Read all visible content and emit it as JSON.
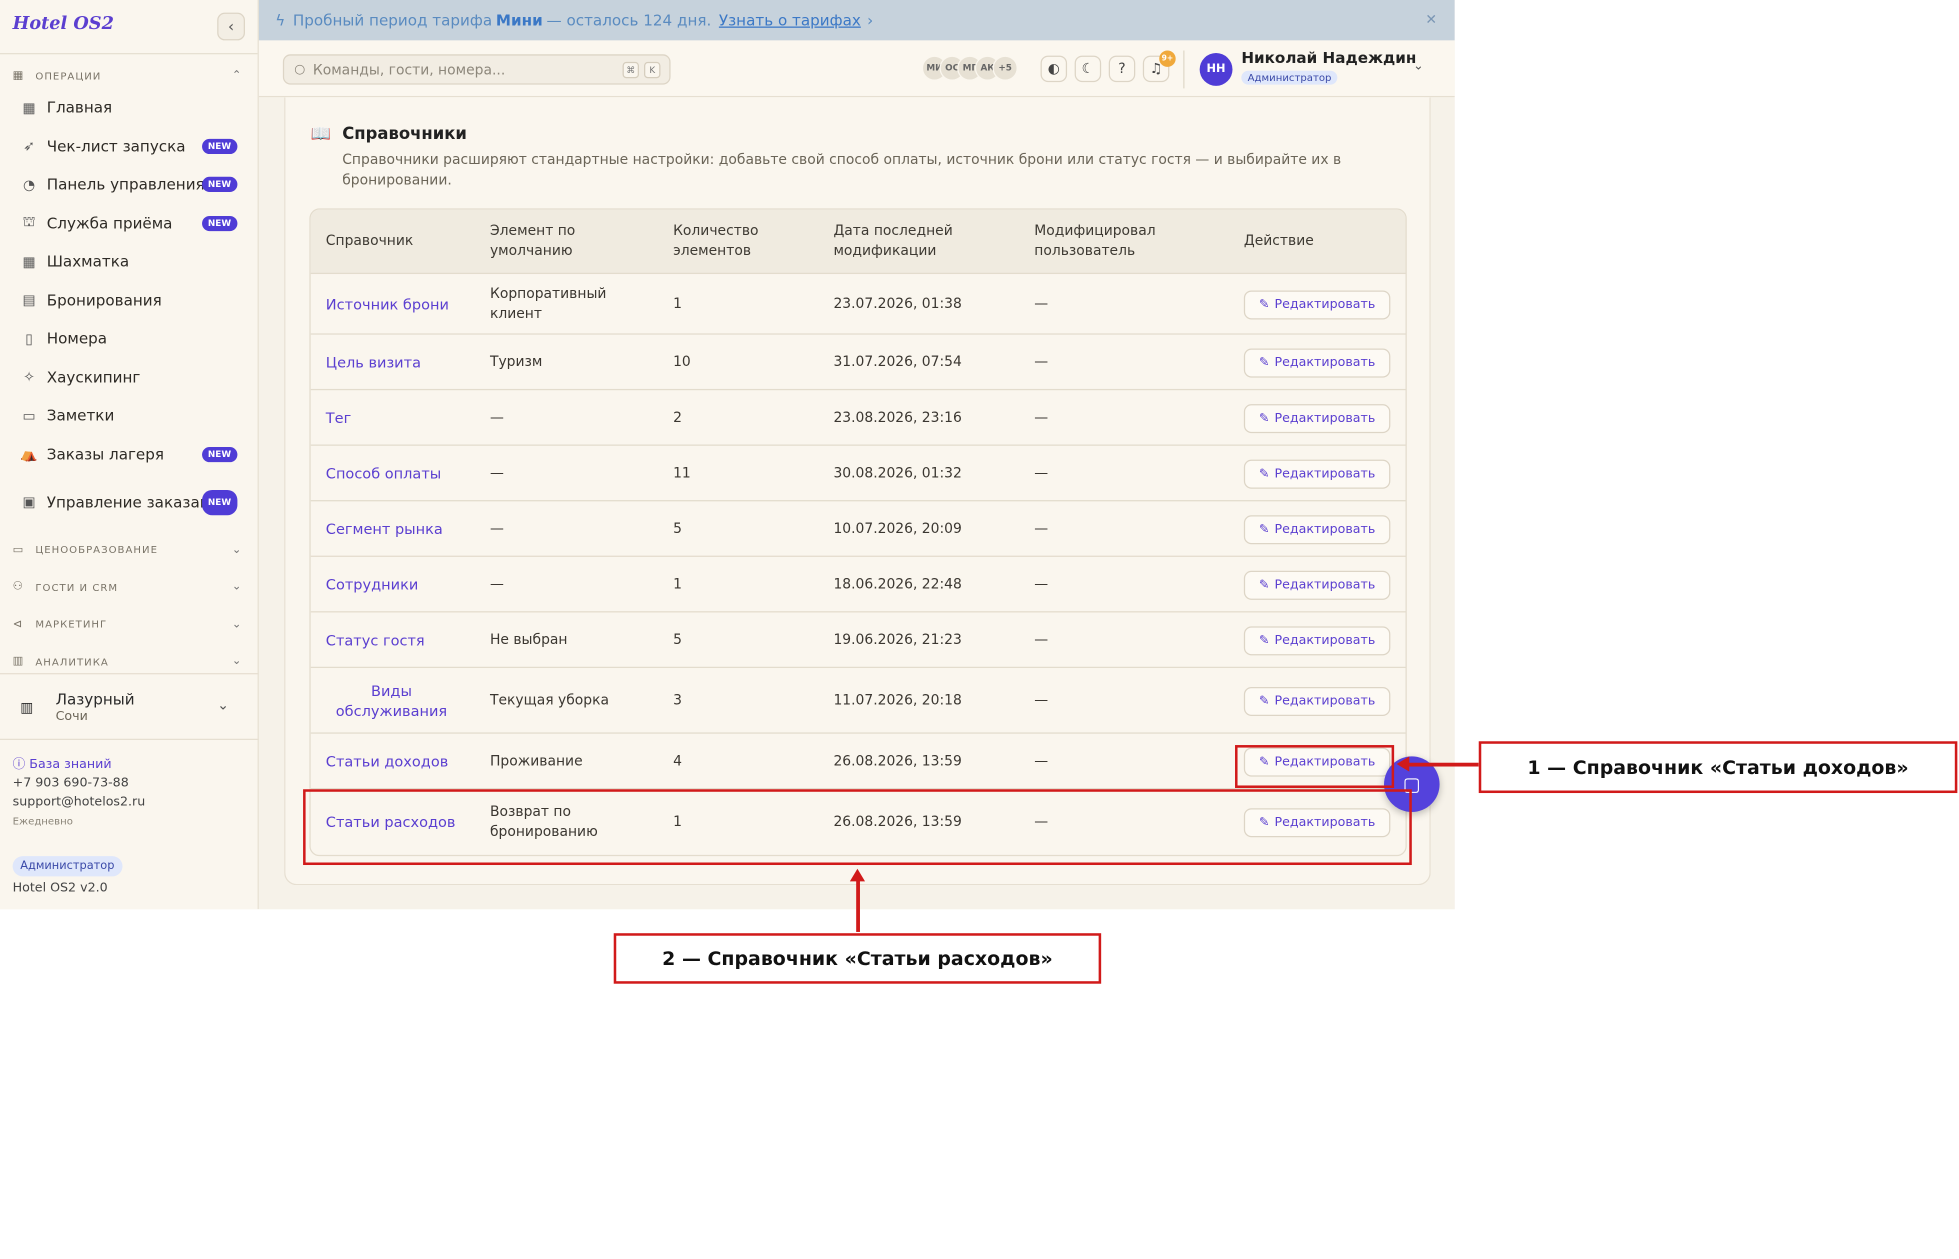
{
  "app": {
    "logo": "Hotel OS2"
  },
  "banner": {
    "text_before": "Пробный период тарифа",
    "plan": "Мини",
    "text_after": "— осталось 124 дня.",
    "link": "Узнать о тарифах"
  },
  "sidebar": {
    "section_operations": "ОПЕРАЦИИ",
    "items": [
      {
        "label": "Главная",
        "icon": "grid-icon",
        "badge": ""
      },
      {
        "label": "Чек-лист запуска",
        "icon": "rocket-icon",
        "badge": "NEW"
      },
      {
        "label": "Панель управления",
        "icon": "gauge-icon",
        "badge": "NEW"
      },
      {
        "label": "Служба приёма",
        "icon": "bell-desk-icon",
        "badge": "NEW"
      },
      {
        "label": "Шахматка",
        "icon": "table-icon",
        "badge": ""
      },
      {
        "label": "Бронирования",
        "icon": "clipboard-icon",
        "badge": ""
      },
      {
        "label": "Номера",
        "icon": "door-icon",
        "badge": ""
      },
      {
        "label": "Хаускипинг",
        "icon": "sparkle-icon",
        "badge": ""
      },
      {
        "label": "Заметки",
        "icon": "note-icon",
        "badge": ""
      },
      {
        "label": "Заказы лагеря",
        "icon": "tent-icon",
        "badge": "NEW"
      },
      {
        "label": "Управление заказами",
        "icon": "receipt-icon",
        "badge": "NEW"
      }
    ],
    "sections": [
      "ЦЕНООБРАЗОВАНИЕ",
      "ГОСТИ И CRM",
      "МАРКЕТИНГ",
      "АНАЛИТИКА"
    ],
    "hotel": {
      "name": "Лазурный",
      "city": "Сочи"
    },
    "knowledge_base": "База знаний",
    "phone": "+7 903 690-73-88",
    "email": "support@hotelos2.ru",
    "hours": "Ежедневно",
    "role": "Администратор",
    "version": "Hotel OS2 v2.0"
  },
  "topbar": {
    "search_placeholder": "Команды, гости, номера...",
    "kbd1": "⌘",
    "kbd2": "K",
    "avatars": [
      "МИ",
      "ОС",
      "МГ",
      "АК",
      "+5"
    ],
    "notif_count": "9+",
    "user_initials": "НН",
    "user_name": "Николай Надеждин",
    "user_role": "Администратор"
  },
  "page": {
    "title": "Справочники",
    "description": "Справочники расширяют стандартные настройки: добавьте свой способ оплаты, источник брони или статус гостя — и выбирайте их в бронировании."
  },
  "table": {
    "headers": [
      "Справочник",
      "Элемент по умолчанию",
      "Количество элементов",
      "Дата последней модификации",
      "Модифицировал пользователь",
      "Действие"
    ],
    "edit_label": "Редактировать",
    "rows": [
      {
        "name": "Источник брони",
        "default": "Корпоративный клиент",
        "count": "1",
        "date": "23.07.2026, 01:38",
        "user": "—"
      },
      {
        "name": "Цель визита",
        "default": "Туризм",
        "count": "10",
        "date": "31.07.2026, 07:54",
        "user": "—"
      },
      {
        "name": "Тег",
        "default": "—",
        "count": "2",
        "date": "23.08.2026, 23:16",
        "user": "—"
      },
      {
        "name": "Способ оплаты",
        "default": "—",
        "count": "11",
        "date": "30.08.2026, 01:32",
        "user": "—"
      },
      {
        "name": "Сегмент рынка",
        "default": "—",
        "count": "5",
        "date": "10.07.2026, 20:09",
        "user": "—"
      },
      {
        "name": "Сотрудники",
        "default": "—",
        "count": "1",
        "date": "18.06.2026, 22:48",
        "user": "—"
      },
      {
        "name": "Статус гостя",
        "default": "Не выбран",
        "count": "5",
        "date": "19.06.2026, 21:23",
        "user": "—"
      },
      {
        "name": "Виды обслуживания",
        "default": "Текущая уборка",
        "count": "3",
        "date": "11.07.2026, 20:18",
        "user": "—"
      },
      {
        "name": "Статьи доходов",
        "default": "Проживание",
        "count": "4",
        "date": "26.08.2026, 13:59",
        "user": "—"
      },
      {
        "name": "Статьи расходов",
        "default": "Возврат по бронированию",
        "count": "1",
        "date": "26.08.2026, 13:59",
        "user": "—"
      }
    ]
  },
  "annotations": {
    "label1": "1 — Справочник «Статьи доходов»",
    "label2": "2 — Справочник «Статьи расходов»",
    "color": "#d11a1a"
  }
}
